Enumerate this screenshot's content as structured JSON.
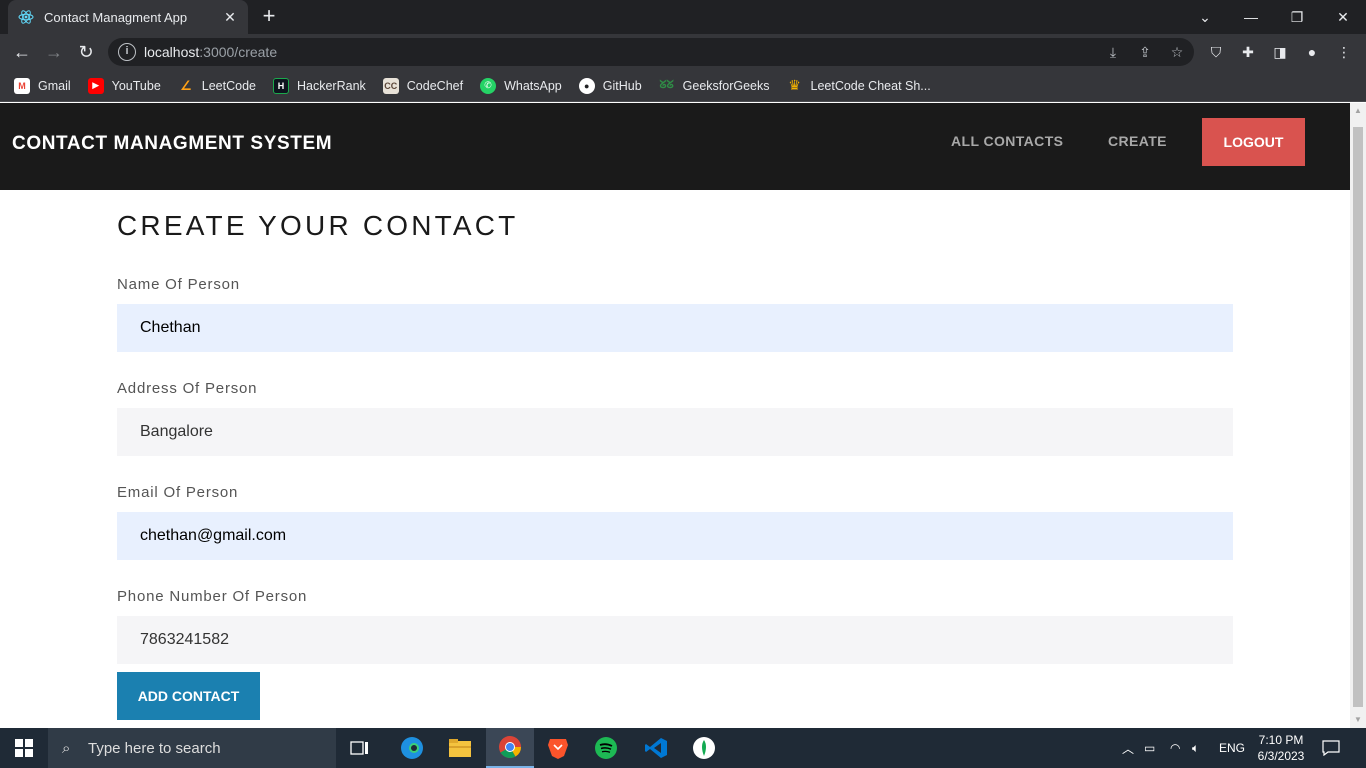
{
  "browser": {
    "tab_title": "Contact Managment App",
    "url_host": "localhost",
    "url_path": ":3000/create",
    "bookmarks": [
      {
        "label": "Gmail",
        "icon": "gmail-icon",
        "color": "#ea4335"
      },
      {
        "label": "YouTube",
        "icon": "youtube-icon",
        "color": "#ff0000"
      },
      {
        "label": "LeetCode",
        "icon": "leetcode-icon",
        "color": "#ffa116"
      },
      {
        "label": "HackerRank",
        "icon": "hackerrank-icon",
        "color": "#1ba94c"
      },
      {
        "label": "CodeChef",
        "icon": "codechef-icon",
        "color": "#5b4638"
      },
      {
        "label": "WhatsApp",
        "icon": "whatsapp-icon",
        "color": "#25d366"
      },
      {
        "label": "GitHub",
        "icon": "github-icon",
        "color": "#ffffff"
      },
      {
        "label": "GeeksforGeeks",
        "icon": "geeksforgeeks-icon",
        "color": "#2f8d46"
      },
      {
        "label": "LeetCode Cheat Sh...",
        "icon": "crown-icon",
        "color": "#f5b400"
      }
    ]
  },
  "app": {
    "brand": "CONTACT MANAGMENT SYSTEM",
    "nav": {
      "all_contacts": "ALL CONTACTS",
      "create": "CREATE",
      "logout": "LOGOUT"
    },
    "page_title": "CREATE YOUR CONTACT",
    "form": {
      "name_label": "Name Of Person",
      "name_value": "Chethan",
      "address_label": "Address Of Person",
      "address_value": "Bangalore",
      "email_label": "Email Of Person",
      "email_value": "chethan@gmail.com",
      "phone_label": "Phone Number Of Person",
      "phone_value": "7863241582",
      "submit_label": "ADD CONTACT"
    },
    "colors": {
      "navbar": "#1a1a1a",
      "logout": "#d9534f",
      "submit": "#1b80b0",
      "autofill": "#e8f0fe"
    }
  },
  "taskbar": {
    "search_placeholder": "Type here to search",
    "language": "ENG",
    "time": "7:10 PM",
    "date": "6/3/2023"
  }
}
